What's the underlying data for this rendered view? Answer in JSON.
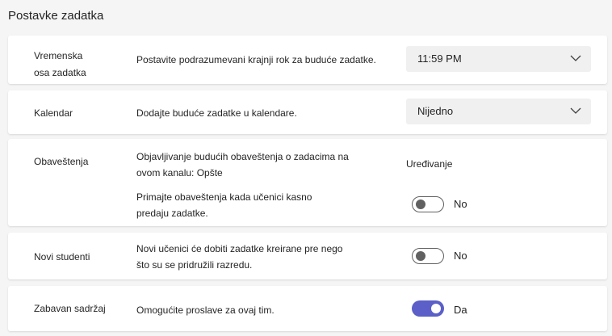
{
  "header": {
    "title": "Postavke zadatka"
  },
  "sections": {
    "timeline": {
      "label_line1": "Vremenska",
      "label_line2": "osa zadatka",
      "description": "Postavite podrazumevani krajnji rok za buduće zadatke.",
      "select_value": "11:59 PM"
    },
    "calendar": {
      "label": "Kalendar",
      "description": "Dodajte buduće zadatke u kalendare.",
      "select_value": "Nijedno"
    },
    "notifications": {
      "label": "Obaveštenja",
      "post_desc_line1": "Objavljivanje budućih obaveštenja o zadacima na",
      "post_desc_line2": "ovom kanalu: Opšte",
      "edit_link": "Uređivanje",
      "late_desc_line1": "Primajte obaveštenja kada učenici kasno",
      "late_desc_line2": "predaju zadatke.",
      "late_toggle_text": "No",
      "late_toggle_on": false
    },
    "new_students": {
      "label": "Novi studenti",
      "desc_line1": "Novi učenici će dobiti zadatke kreirane pre nego",
      "desc_line2": "što su se pridružili razredu.",
      "toggle_text": "No",
      "toggle_on": false
    },
    "fun": {
      "label": "Zabavan sadržaj",
      "description": "Omogućite proslave za ovaj tim.",
      "toggle_text": "Da",
      "toggle_on": true
    }
  },
  "colors": {
    "accent": "#5b5fc7",
    "card": "#ffffff",
    "background": "#f5f5f5"
  },
  "icons": {
    "dropdown": "chevron-down-icon"
  }
}
